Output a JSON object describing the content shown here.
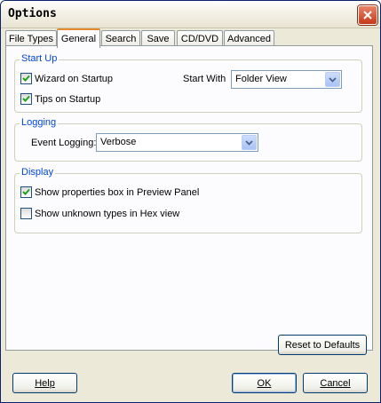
{
  "window": {
    "title": "Options"
  },
  "tabs": [
    {
      "label": "File Types"
    },
    {
      "label": "General"
    },
    {
      "label": "Search"
    },
    {
      "label": "Save"
    },
    {
      "label": "CD/DVD"
    },
    {
      "label": "Advanced"
    }
  ],
  "active_tab": "General",
  "startup": {
    "legend": "Start Up",
    "wizard_label": "Wizard on Startup",
    "wizard_checked": true,
    "tips_label": "Tips on Startup",
    "tips_checked": true,
    "start_with_label": "Start With",
    "start_with_value": "Folder View"
  },
  "logging": {
    "legend": "Logging",
    "event_label": "Event Logging:",
    "event_value": "Verbose"
  },
  "display": {
    "legend": "Display",
    "show_props_label": "Show properties box in Preview Panel",
    "show_props_checked": true,
    "show_unknown_label": "Show unknown types in Hex view",
    "show_unknown_checked": false
  },
  "buttons": {
    "reset": "Reset to Defaults",
    "help": "Help",
    "ok": "OK",
    "cancel": "Cancel"
  },
  "colors": {
    "legend_text": "#0046d5",
    "close_button": "#c5391a",
    "active_tab_accent": "#e68b2c",
    "checkmark": "#21a121"
  }
}
